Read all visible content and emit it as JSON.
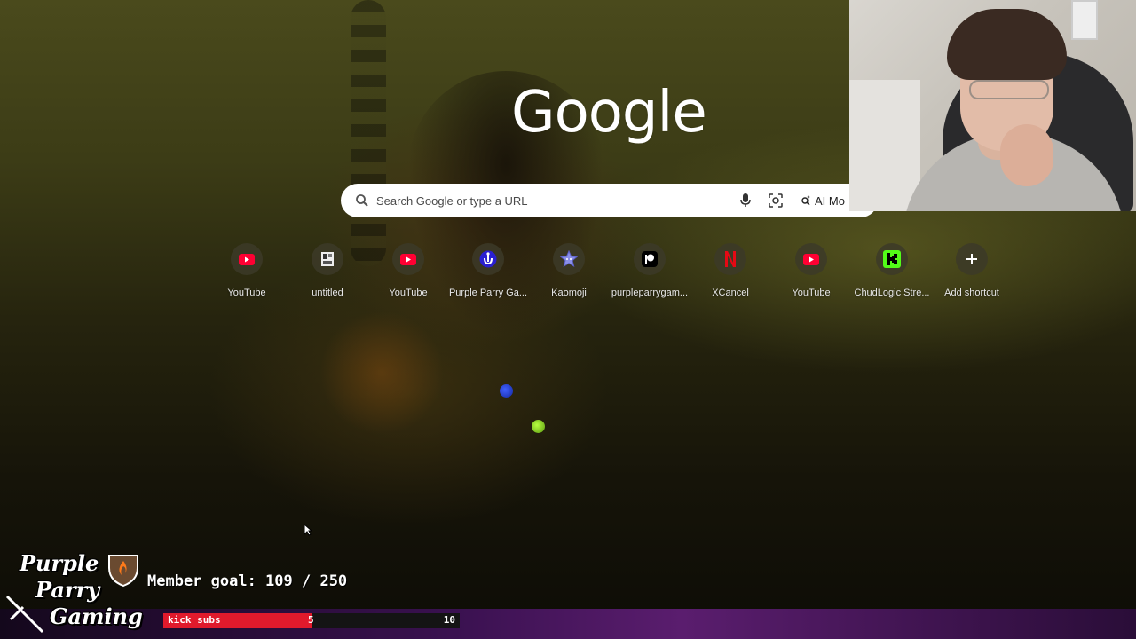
{
  "browser": {
    "logo_text": "Google",
    "search": {
      "placeholder": "Search Google or type a URL",
      "ai_mode_label": "AI Mo"
    },
    "shortcuts": [
      {
        "label": "YouTube",
        "icon": "youtube-icon",
        "color": "#ff0033"
      },
      {
        "label": "untitled",
        "icon": "document-icon",
        "color": "#dddddd"
      },
      {
        "label": "YouTube",
        "icon": "youtube-icon",
        "color": "#ff0033"
      },
      {
        "label": "Purple Parry Ga...",
        "icon": "purple-parry-icon",
        "color": "#3a2bd8"
      },
      {
        "label": "Kaomoji",
        "icon": "star-icon",
        "color": "#8a8fe8"
      },
      {
        "label": "purpleparrygam...",
        "icon": "patreon-icon",
        "color": "#000000"
      },
      {
        "label": "XCancel",
        "icon": "netflix-icon",
        "color": "#e50914"
      },
      {
        "label": "YouTube",
        "icon": "youtube-icon",
        "color": "#ff0033"
      },
      {
        "label": "ChudLogic Stre...",
        "icon": "kick-icon",
        "color": "#53fc18"
      },
      {
        "label": "Add shortcut",
        "icon": "plus-icon",
        "color": "#ffffff"
      }
    ]
  },
  "stream_overlay": {
    "channel_logo": [
      "Purple",
      "Parry",
      "Gaming"
    ],
    "member_goal": "Member goal: 109 / 250",
    "sub_bar": {
      "label": "kick subs",
      "current": "5",
      "goal": "10",
      "progress": 0.5
    }
  }
}
